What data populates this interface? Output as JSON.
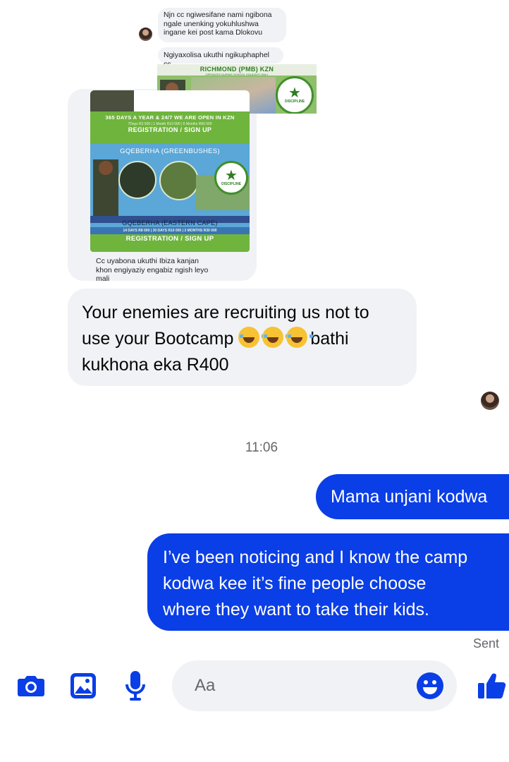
{
  "thread": {
    "quoted_messages": [
      {
        "text": "Njn cc ngiwesifane nami ngibona ngale unenking yokuhlushwa ingane kei post kama Dlokovu"
      },
      {
        "text": "Ngiyaxolisa ukuthi ngikuphaphel cc"
      }
    ],
    "poster_top": {
      "title": "RICHMOND (PMB) KZN",
      "subtitle": "OPERATES DURING SCHOOL HOLIDAYS ONLY",
      "logo_text": "DISCIPLINE"
    },
    "poster_main": {
      "banner_top": "365 DAYS A YEAR & 24/7 WE ARE OPEN IN KZN",
      "prices_line": "7Days R3 500 | 1 Month R10 000 | 6 Months R60 000",
      "register_1": "REGISTRATION / SIGN UP",
      "location_header": "GQEBERHA (GREENBUSHES)",
      "logo_text": "DISCIPLINE",
      "location_footer": "GQEBERHA (EASTERN CAPE)",
      "prices_line_2": "14 DAYS R8 000 | 30 DAYS R10 000 | 3 MONTHS R30 000",
      "register_2": "REGISTRATION / SIGN UP"
    },
    "quoted_caption": "Cc uyabona ukuthi Ibiza kanjan khon engiyaziy engabiz ngish leyo mali",
    "reply_message": {
      "line1": "Your enemies are recruiting us not to",
      "line2_before": "use your Bootcamp ",
      "line2_after": "bathi",
      "line3": "kukhona eka R400",
      "emoji_count": 3,
      "emoji_name": "face-with-tears-of-joy"
    },
    "timestamp": "11:06",
    "outgoing": [
      {
        "text": "Mama unjani kodwa"
      },
      {
        "lines": [
          "I’ve been noticing and I know the camp",
          "kodwa kee it’s fine people choose",
          "where they want to take their kids."
        ]
      }
    ],
    "status": "Sent"
  },
  "composer": {
    "placeholder": "Aa",
    "icons": [
      "camera-icon",
      "gallery-icon",
      "microphone-icon",
      "emoji-icon",
      "thumbs-up-icon"
    ]
  },
  "colors": {
    "accent": "#0a3ee6",
    "incoming_bubble": "#f0f2f5",
    "poster_green": "#6fb43c"
  }
}
